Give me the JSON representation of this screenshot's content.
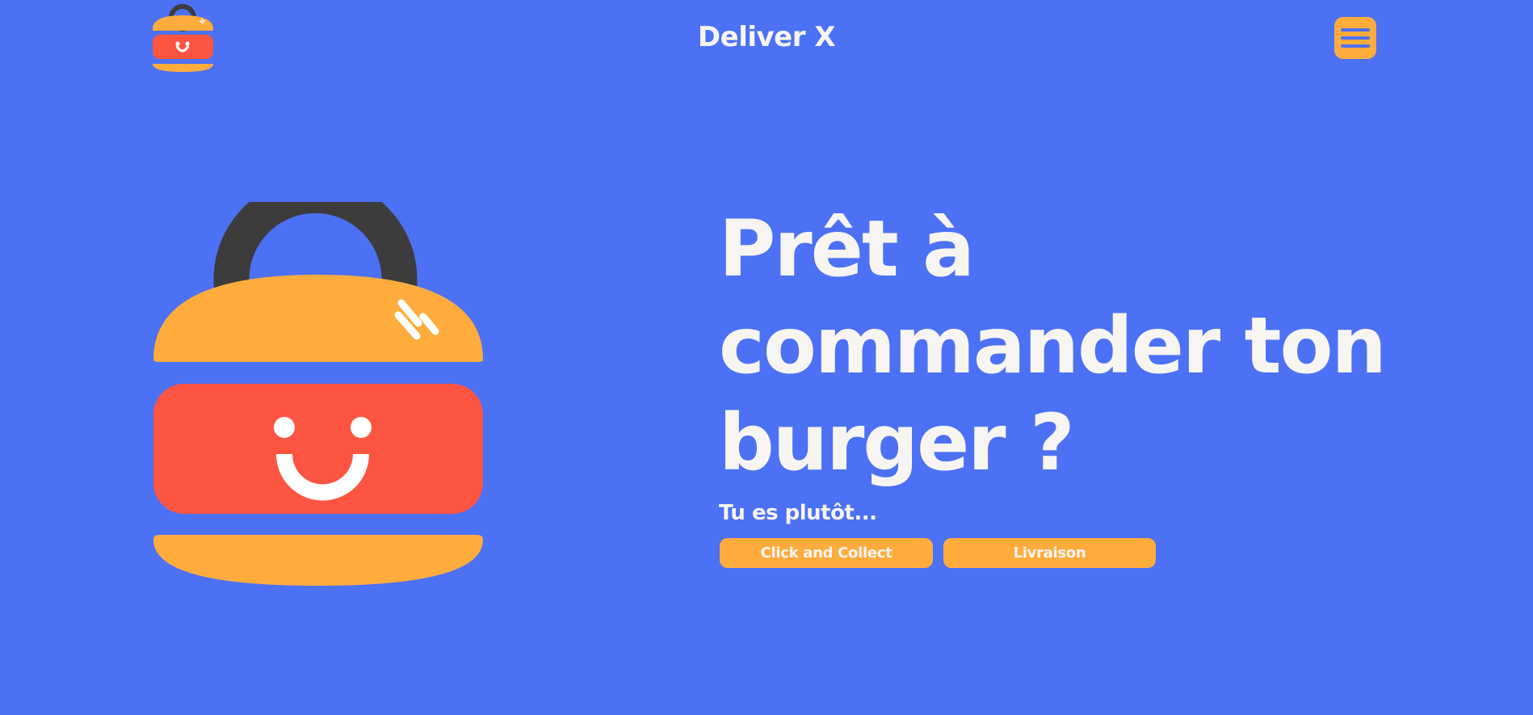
{
  "colors": {
    "background": "#4c71f5",
    "primary_orange": "#ffac3d",
    "accent_red": "#fd5542",
    "handle_dark": "#3c3c3c",
    "text_light": "#f7f5f2"
  },
  "header": {
    "logo_icon": "burger-bag-logo-icon",
    "brand": "Deliver X",
    "menu_icon": "hamburger-menu-icon"
  },
  "hero": {
    "mascot_icon": "burger-bag-mascot-icon",
    "title_line1": "Prêt à",
    "title_line2": "commander ton",
    "title_line3": "burger ?",
    "subtitle": "Tu es plutôt...",
    "cta_click_collect": "Click and Collect",
    "cta_delivery": "Livraison"
  }
}
